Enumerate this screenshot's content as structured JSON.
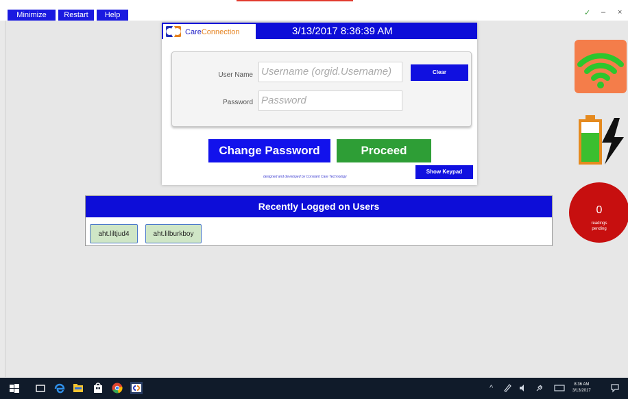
{
  "toolbar": {
    "minimize_label": "Minimize",
    "restart_label": "Restart",
    "help_label": "Help"
  },
  "window_controls": {
    "check_glyph": "✓",
    "minimize_glyph": "–",
    "close_glyph": "×"
  },
  "login": {
    "logo_care": "Care",
    "logo_connection": "Connection",
    "datetime": "3/13/2017 8:36:39 AM",
    "username_label": "User Name",
    "username_placeholder": "Username (orgid.Username)",
    "password_label": "Password",
    "password_placeholder": "Password",
    "clear_label": "Clear",
    "change_password_label": "Change Password",
    "proceed_label": "Proceed",
    "show_keypad_label": "Show Keypad",
    "credit": "designed and developed by Constant Care Technology"
  },
  "recent_users": {
    "title": "Recently Logged on Users",
    "users": [
      "aht.liltjud4",
      "aht.lilburkboy"
    ]
  },
  "status": {
    "wifi_icon": "wifi-icon",
    "battery_icon": "battery-charging-icon",
    "pending_count": "0",
    "pending_label": "readings pending"
  },
  "taskbar": {
    "time": "8:36 AM",
    "date": "3/13/2017",
    "tray_chevron": "^"
  },
  "colors": {
    "brand_blue": "#0d0dd8",
    "proceed_green": "#2e9e36",
    "pending_red": "#c70f0f",
    "wifi_orange": "#f47d4a",
    "wifi_green": "#2dc62d"
  }
}
